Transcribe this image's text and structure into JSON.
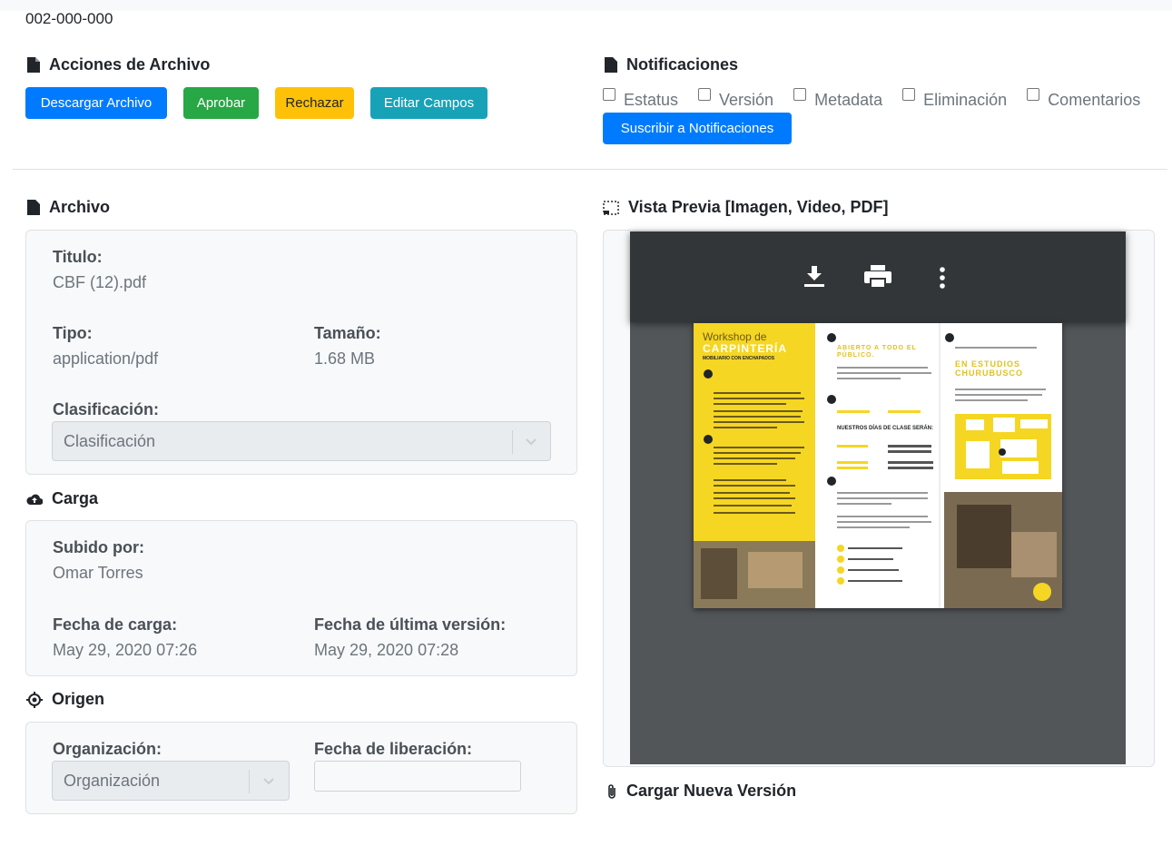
{
  "doc_number": "002-000-000",
  "actions": {
    "title": "Acciones de Archivo",
    "download": "Descargar Archivo",
    "approve": "Aprobar",
    "reject": "Rechazar",
    "edit": "Editar Campos"
  },
  "notifications": {
    "title": "Notificaciones",
    "options": [
      "Estatus",
      "Versión",
      "Metadata",
      "Eliminación",
      "Comentarios"
    ],
    "subscribe": "Suscribir a Notificaciones"
  },
  "archivo": {
    "title": "Archivo",
    "title_label": "Titulo:",
    "title_value": "CBF (12).pdf",
    "type_label": "Tipo:",
    "type_value": "application/pdf",
    "size_label": "Tamaño:",
    "size_value": "1.68 MB",
    "class_label": "Clasificación:",
    "class_placeholder": "Clasificación"
  },
  "carga": {
    "title": "Carga",
    "uploaded_by_label": "Subido por:",
    "uploaded_by_value": "Omar Torres",
    "upload_date_label": "Fecha de carga:",
    "upload_date_value": "May 29, 2020 07:26",
    "last_version_label": "Fecha de última versión:",
    "last_version_value": "May 29, 2020 07:28"
  },
  "origen": {
    "title": "Origen",
    "org_label": "Organización:",
    "org_placeholder": "Organización",
    "release_label": "Fecha de liberación:",
    "release_value": ""
  },
  "preview": {
    "title": "Vista Previa [Imagen, Video, PDF]",
    "pdf": {
      "workshop": "Workshop de",
      "carpinteria": "CARPINTERÍA",
      "subtitle": "MOBILIARIO CON ENCHAPADOS",
      "open": "ABIERTO A TODO EL PÚBLICO.",
      "days": "NUESTROS DÍAS DE CLASE SERÁN:",
      "place": "EN ESTUDIOS CHURUBUSCO"
    }
  },
  "upload_new": {
    "title": "Cargar Nueva Versión"
  },
  "colors": {
    "primary": "#007bff",
    "success": "#28a745",
    "warning": "#ffc107",
    "info": "#17a2b8",
    "pdf_yellow": "#f5d623"
  }
}
